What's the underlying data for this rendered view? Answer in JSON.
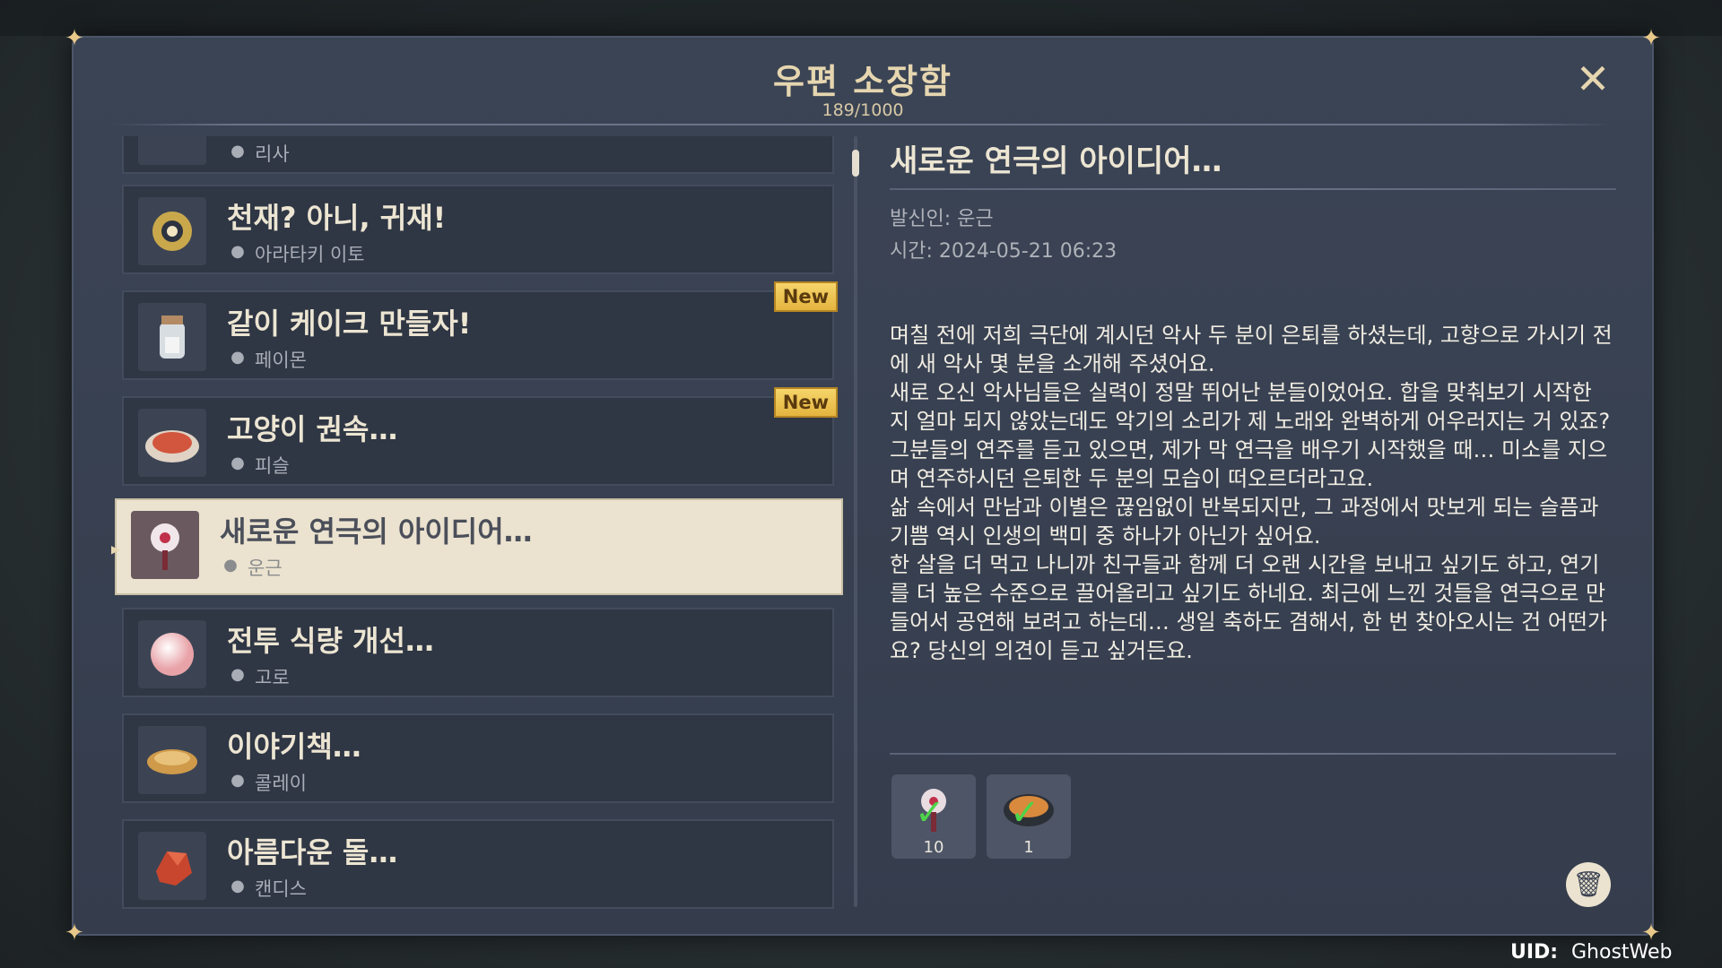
{
  "mailbox": {
    "title": "우편 소장함",
    "count": "189/1000"
  },
  "mails": [
    {
      "subject": "",
      "sender": "리사",
      "new": false,
      "selected": false
    },
    {
      "subject": "천재? 아니, 귀재!",
      "sender": "아라타키 이토",
      "new": false,
      "selected": false
    },
    {
      "subject": "같이 케이크 만들자!",
      "sender": "페이몬",
      "new": true,
      "selected": false
    },
    {
      "subject": "고양이 권속…",
      "sender": "피슬",
      "new": true,
      "selected": false
    },
    {
      "subject": "새로운 연극의 아이디어…",
      "sender": "운근",
      "new": false,
      "selected": true
    },
    {
      "subject": "전투 식량 개선…",
      "sender": "고로",
      "new": false,
      "selected": false
    },
    {
      "subject": "이야기책…",
      "sender": "콜레이",
      "new": false,
      "selected": false
    },
    {
      "subject": "아름다운 돌…",
      "sender": "캔디스",
      "new": false,
      "selected": false
    }
  ],
  "badge_label": "New",
  "detail": {
    "title": "새로운 연극의 아이디어…",
    "sender_line": "발신인: 운근",
    "time_line": "시간: 2024-05-21 06:23",
    "body": "며칠 전에 저희 극단에 계시던 악사 두 분이 은퇴를 하셨는데, 고향으로 가시기 전에 새 악사 몇 분을 소개해 주셨어요.\n새로 오신 악사님들은 실력이 정말 뛰어난 분들이었어요. 합을 맞춰보기 시작한 지 얼마 되지 않았는데도 악기의 소리가 제 노래와 완벽하게 어우러지는 거 있죠? 그분들의 연주를 듣고 있으면, 제가 막 연극을 배우기 시작했을 때… 미소를 지으며 연주하시던 은퇴한 두 분의 모습이 떠오르더라고요.\n삶 속에서 만남과 이별은 끊임없이 반복되지만, 그 과정에서 맛보게 되는 슬픔과 기쁨 역시 인생의 백미 중 하나가 아닌가 싶어요.\n한 살을 더 먹고 나니까 친구들과 함께 더 오랜 시간을 보내고 싶기도 하고, 연기를 더 높은 수준으로 끌어올리고 싶기도 하네요. 최근에 느낀 것들을 연극으로 만들어서 공연해 보려고 하는데… 생일 축하도 겸해서, 한 번 찾아오시는 건 어떤가요? 당신의 의견이 듣고 싶거든요.",
    "attachments": [
      {
        "icon": "flower-item-icon",
        "quantity": "10",
        "claimed": true
      },
      {
        "icon": "soup-bowl-icon",
        "quantity": "1",
        "claimed": true
      }
    ]
  },
  "uid": {
    "label": "UID:",
    "value": "GhostWeb"
  },
  "colors": {
    "panel": "#353d4d",
    "selected_row": "#ebe3cf",
    "badge": "#e4b43f",
    "title_gold": "#e6d6b0"
  }
}
